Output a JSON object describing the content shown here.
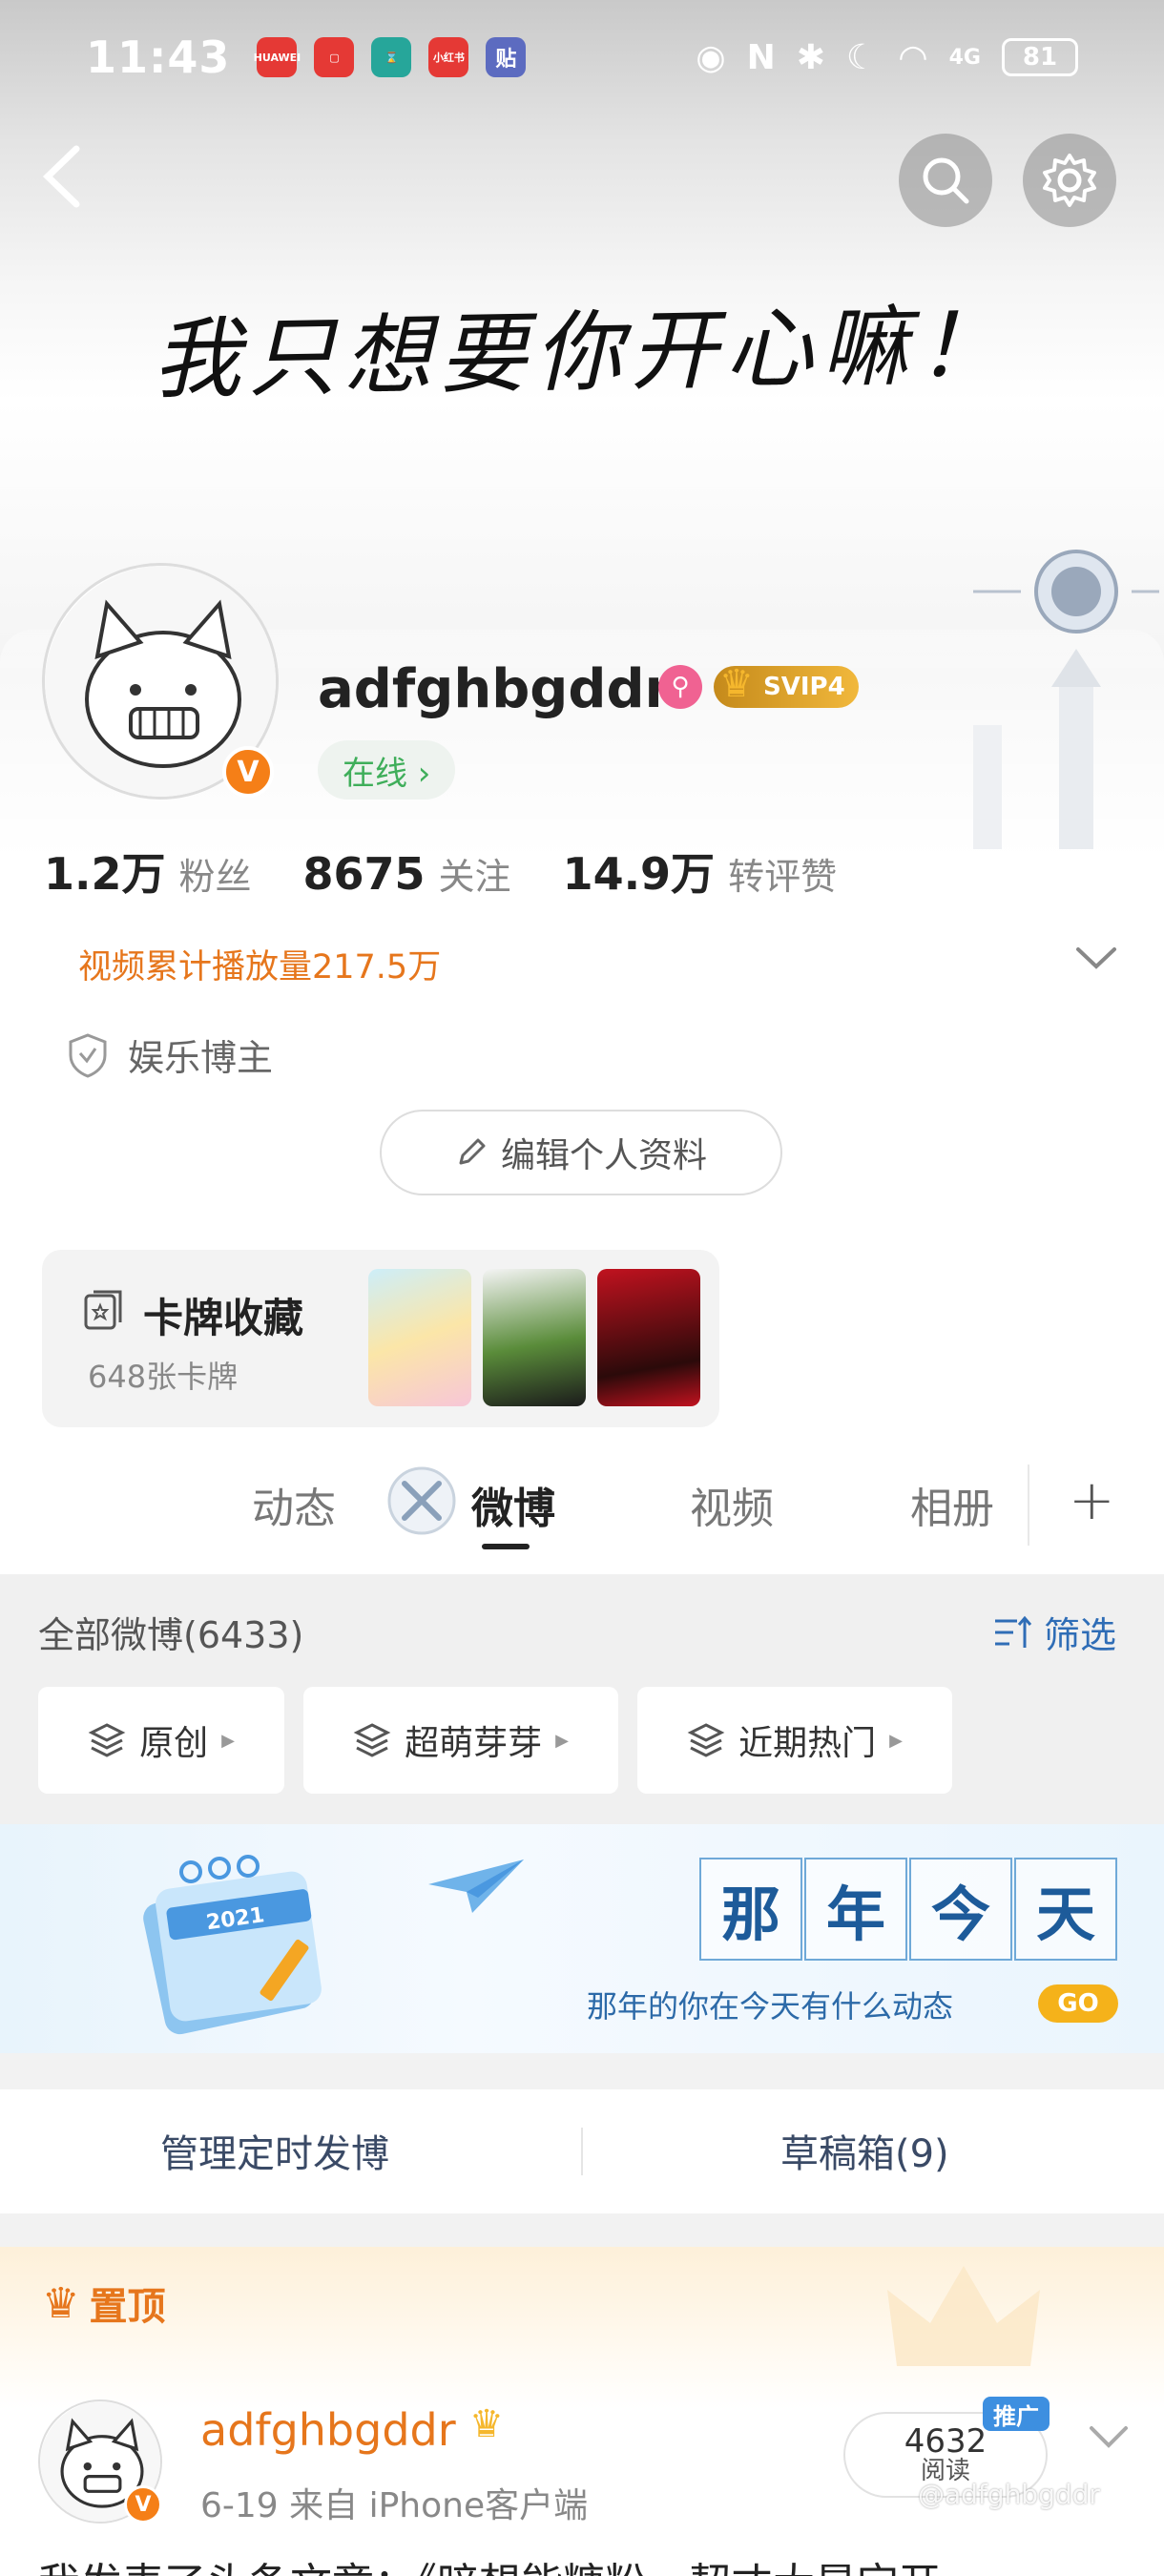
{
  "status_bar": {
    "time": "11:43",
    "battery": "81",
    "network": "4G",
    "apps": [
      {
        "label": "HUAWEI",
        "color": "#e53935"
      },
      {
        "label": "",
        "color": "#e53935"
      },
      {
        "label": "",
        "color": "#26a69a"
      },
      {
        "label": "小红书",
        "color": "#e53935"
      },
      {
        "label": "贴",
        "color": "#5c6bc0"
      }
    ]
  },
  "header": {
    "cover_text": "我只想要你开心嘛！",
    "back_icon": "chevron-left-icon",
    "search_icon": "search-icon",
    "settings_icon": "gear-icon"
  },
  "profile": {
    "username": "adfghbgddr",
    "verified_badge": "V",
    "svip_label": "SVIP4",
    "online_label": "在线 ›",
    "stats": [
      {
        "value": "1.2万",
        "label": "粉丝"
      },
      {
        "value": "8675",
        "label": "关注"
      },
      {
        "value": "14.9万",
        "label": "转评赞"
      }
    ],
    "video_plays": "视频累计播放量217.5万",
    "category": "娱乐博主",
    "edit_button": "编辑个人资料"
  },
  "cards": {
    "title": "卡牌收藏",
    "count": "648张卡牌"
  },
  "tabs": [
    {
      "label": "动态",
      "active": false
    },
    {
      "label": "微博",
      "active": true
    },
    {
      "label": "视频",
      "active": false
    },
    {
      "label": "相册",
      "active": false
    }
  ],
  "filter": {
    "all_label": "全部微博(6433)",
    "filter_label": "筛选",
    "chips": [
      "原创",
      "超萌芽芽",
      "近期热门"
    ]
  },
  "that_year_today": {
    "chars": [
      "那",
      "年",
      "今",
      "天"
    ],
    "subtitle": "那年的你在今天有什么动态",
    "go": "GO",
    "calendar_year": "2021"
  },
  "manage": {
    "scheduled": "管理定时发博",
    "drafts": "草稿箱(9)"
  },
  "pinned_post": {
    "pinned_label": "置顶",
    "username": "adfghbgddr",
    "meta": "6-19  来自 iPhone客户端",
    "reads_count": "4632",
    "reads_label": "阅读",
    "promo_tag": "推广",
    "text_preview": "我发表了头条文章：《暗想能糖粉，契丈大是宝开",
    "watermark": "@adfghbgddr"
  }
}
